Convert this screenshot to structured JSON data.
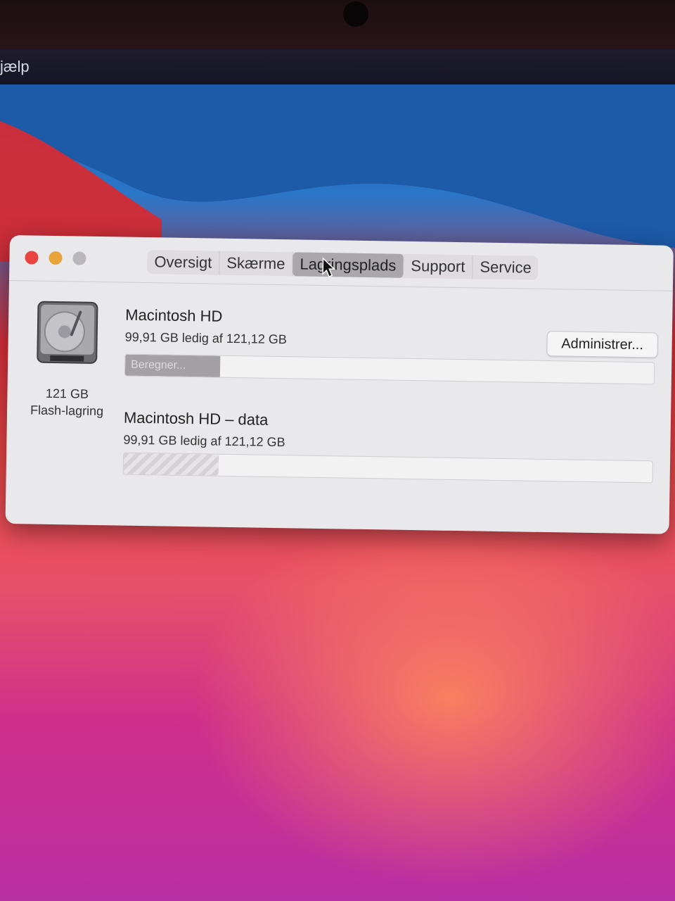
{
  "menubar": {
    "help_label": "jælp"
  },
  "window": {
    "tabs": [
      {
        "label": "Oversigt"
      },
      {
        "label": "Skærme"
      },
      {
        "label": "Lagringsplads",
        "active": true
      },
      {
        "label": "Support"
      },
      {
        "label": "Service"
      }
    ],
    "disk": {
      "size": "121 GB",
      "type": "Flash-lagring"
    },
    "volumes": [
      {
        "name": "Macintosh HD",
        "free": "99,91 GB ledig af 121,12 GB",
        "bar_text": "Beregner...",
        "used_fraction": 0.18
      },
      {
        "name": "Macintosh HD – data",
        "free": "99,91 GB ledig af 121,12 GB",
        "bar_text": "",
        "used_fraction": 0.18
      }
    ],
    "manage_button": "Administrer..."
  },
  "colors": {
    "close": "#e9443f",
    "minimize": "#e8a43a",
    "zoom": "#b9b7ba"
  }
}
